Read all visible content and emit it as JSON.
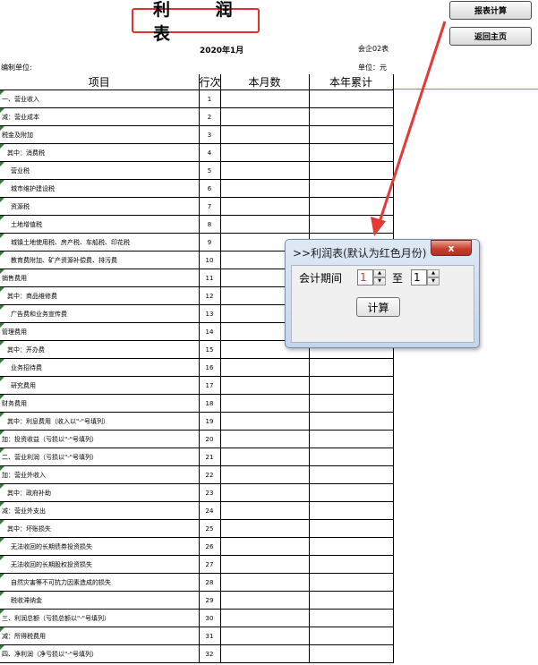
{
  "report": {
    "title": "利 润 表",
    "date": "2020年1月",
    "form_no": "会企02表",
    "unit_left": "编制单位:",
    "unit_right": "单位：元"
  },
  "toolbar": {
    "calc_label": "报表计算",
    "home_label": "返回主页"
  },
  "table": {
    "headers": [
      "项目",
      "行次",
      "本月数",
      "本年累计"
    ],
    "rows": [
      {
        "item": "一、营业收入",
        "line": "1",
        "indent": 0
      },
      {
        "item": "减：营业成本",
        "line": "2",
        "indent": 0
      },
      {
        "item": "税金及附加",
        "line": "3",
        "indent": 0
      },
      {
        "item": "其中：消费税",
        "line": "4",
        "indent": 1
      },
      {
        "item": "营业税",
        "line": "5",
        "indent": 2
      },
      {
        "item": "城市维护建设税",
        "line": "6",
        "indent": 2
      },
      {
        "item": "资源税",
        "line": "7",
        "indent": 2
      },
      {
        "item": "土地增值税",
        "line": "8",
        "indent": 2
      },
      {
        "item": "城镇土地使用税、房产税、车船税、印花税",
        "line": "9",
        "indent": 2
      },
      {
        "item": "教育费附加、矿产资源补偿费、排污费",
        "line": "10",
        "indent": 2
      },
      {
        "item": "销售费用",
        "line": "11",
        "indent": 0
      },
      {
        "item": "其中：商品维修费",
        "line": "12",
        "indent": 1
      },
      {
        "item": "广告费和业务宣传费",
        "line": "13",
        "indent": 2
      },
      {
        "item": "管理费用",
        "line": "14",
        "indent": 0
      },
      {
        "item": "其中：开办费",
        "line": "15",
        "indent": 1
      },
      {
        "item": "业务招待费",
        "line": "16",
        "indent": 2
      },
      {
        "item": "研究费用",
        "line": "17",
        "indent": 2
      },
      {
        "item": "财务费用",
        "line": "18",
        "indent": 0
      },
      {
        "item": "其中：利息费用（收入以\"-\"号填列）",
        "line": "19",
        "indent": 1
      },
      {
        "item": "加：投资收益（亏损以\"-\"号填列）",
        "line": "20",
        "indent": 0
      },
      {
        "item": "二、营业利润（亏损以\"-\"号填列）",
        "line": "21",
        "indent": 0
      },
      {
        "item": "加：营业外收入",
        "line": "22",
        "indent": 0
      },
      {
        "item": "其中：政府补助",
        "line": "23",
        "indent": 1
      },
      {
        "item": "减：营业外支出",
        "line": "24",
        "indent": 0
      },
      {
        "item": "其中：坏账损失",
        "line": "25",
        "indent": 1
      },
      {
        "item": "无法收回的长期债券投资损失",
        "line": "26",
        "indent": 2
      },
      {
        "item": "无法收回的长期股权投资损失",
        "line": "27",
        "indent": 2
      },
      {
        "item": "自然灾害等不可抗力因素造成的损失",
        "line": "28",
        "indent": 2
      },
      {
        "item": "税收滞纳金",
        "line": "29",
        "indent": 2
      },
      {
        "item": "三、利润总额（亏损总额以\"-\"号填列）",
        "line": "30",
        "indent": 0
      },
      {
        "item": "减：所得税费用",
        "line": "31",
        "indent": 0
      },
      {
        "item": "四、净利润（净亏损以\"-\"号填列）",
        "line": "32",
        "indent": 0
      }
    ]
  },
  "dialog": {
    "title": ">>利润表(默认为红色月份)",
    "close_label": "x",
    "period_label": "会计期间",
    "from_value": "1",
    "to_label": "至",
    "to_value": "1",
    "up_glyph": "▲",
    "down_glyph": "▼",
    "calc_label": "计算"
  },
  "colors": {
    "title_border": "#e0332c",
    "arrow": "#e53935",
    "row_marker": "#2e7d32",
    "from_value_text": "#d32f2f"
  }
}
